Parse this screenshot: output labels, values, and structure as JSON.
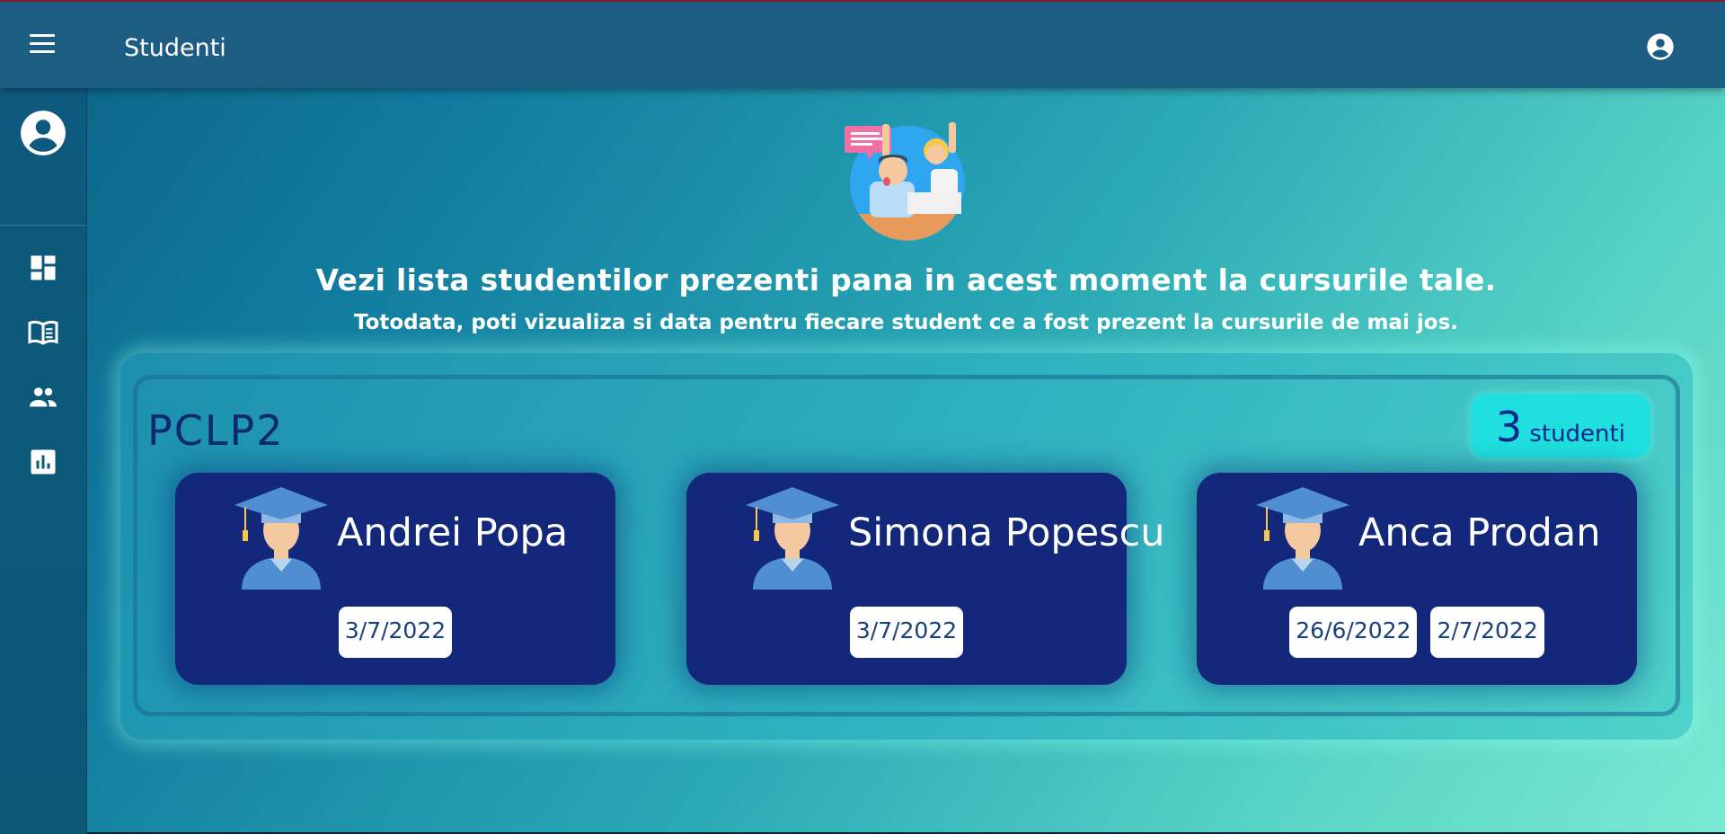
{
  "header": {
    "title": "Studenti",
    "menu_icon": "hamburger-menu-icon",
    "account_icon": "account-circle-icon"
  },
  "sidebar": {
    "avatar_icon": "account-circle-icon",
    "items": [
      {
        "icon": "dashboard-icon"
      },
      {
        "icon": "book-icon"
      },
      {
        "icon": "people-icon"
      },
      {
        "icon": "bar-chart-icon"
      }
    ]
  },
  "hero": {
    "image": "students-raising-hands-illustration",
    "headline": "Vezi lista studentilor prezenti pana in acest moment la cursurile tale.",
    "subline": "Totodata, poti vizualiza si data pentru fiecare student ce a fost prezent la cursurile de mai jos."
  },
  "course": {
    "name": "PCLP2",
    "count": "3",
    "count_label": "studenti",
    "students": [
      {
        "name": "Andrei Popa",
        "dates": [
          "3/7/2022"
        ]
      },
      {
        "name": "Simona Popescu",
        "dates": [
          "3/7/2022"
        ]
      },
      {
        "name": "Anca Prodan",
        "dates": [
          "26/6/2022",
          "2/7/2022"
        ]
      }
    ]
  },
  "colors": {
    "topbar": "#1d5d83",
    "sidebar": "#0d5a7e",
    "card": "#13287a",
    "badge": "#1fe0de",
    "course_title": "#0d2a6f"
  }
}
